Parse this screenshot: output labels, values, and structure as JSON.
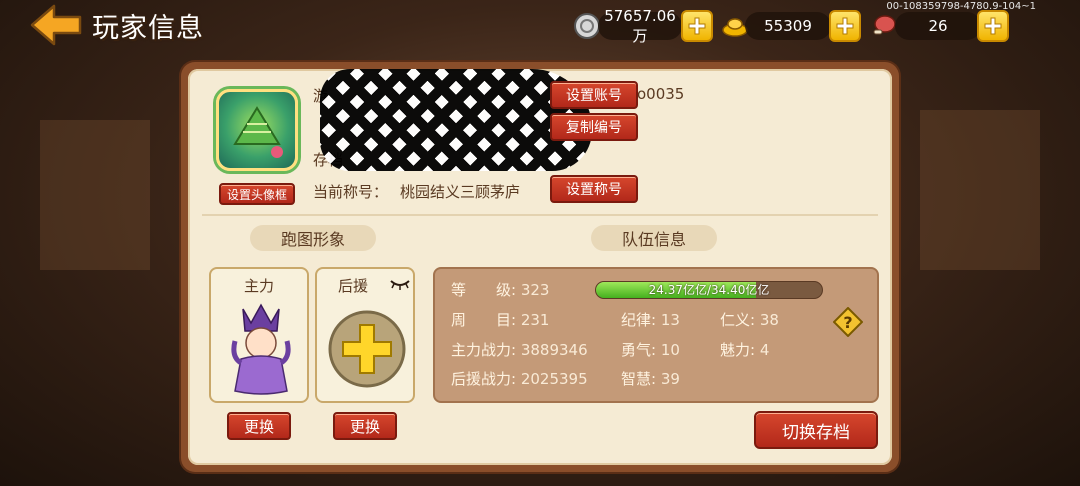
{
  "header": {
    "title": "玩家信息",
    "debug_id": "00-108359798-4780.9-104~1"
  },
  "resources": {
    "silver": "57657.06万",
    "gold": "55309",
    "stamina": "26"
  },
  "profile": {
    "name_prefix": "游",
    "id_suffix": "o0035",
    "save_prefix": "存档",
    "title_label": "当前称号：",
    "title_value": "桃园结义三顾茅庐",
    "buttons": {
      "set_avatar_frame": "设置头像框",
      "set_account": "设置账号",
      "copy_id": "复制编号",
      "set_title": "设置称号"
    }
  },
  "sections": {
    "runner": "跑图形象",
    "team": "队伍信息"
  },
  "slots": {
    "main": "主力",
    "backup": "后援",
    "swap_main": "更换",
    "swap_backup": "更换"
  },
  "team": {
    "level_label": "等　　级:",
    "level": "323",
    "exp_text": "24.37亿亿/34.40亿亿",
    "exp_fraction": 0.708,
    "week_label": "周　　目:",
    "week": "231",
    "discipline_label": "纪律:",
    "discipline": "13",
    "benevolence_label": "仁义:",
    "benevolence": "38",
    "main_power_label": "主力战力:",
    "main_power": "3889346",
    "courage_label": "勇气:",
    "courage": "10",
    "charm_label": "魅力:",
    "charm": "4",
    "backup_power_label": "后援战力:",
    "backup_power": "2025395",
    "wisdom_label": "智慧:",
    "wisdom": "39"
  },
  "actions": {
    "switch_save": "切换存档"
  },
  "colors": {
    "accent_gold": "#f0b400",
    "button_red": "#c2311f",
    "panel_bg": "#f5ebd4",
    "progress_green": "#45b01e"
  }
}
